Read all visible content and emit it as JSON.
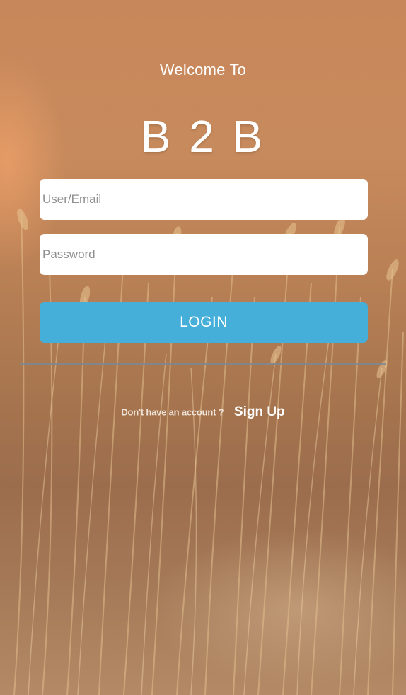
{
  "header": {
    "welcome_text": "Welcome To",
    "brand_name": "B 2 B"
  },
  "form": {
    "user_placeholder": "User/Email",
    "password_placeholder": "Password",
    "login_label": "LOGIN"
  },
  "footer": {
    "no_account_text": "Don't have an account ?",
    "signup_label": "Sign Up"
  },
  "colors": {
    "login_button": "#45afd9",
    "field_background": "#ffffff",
    "divider": "#7d8790"
  }
}
